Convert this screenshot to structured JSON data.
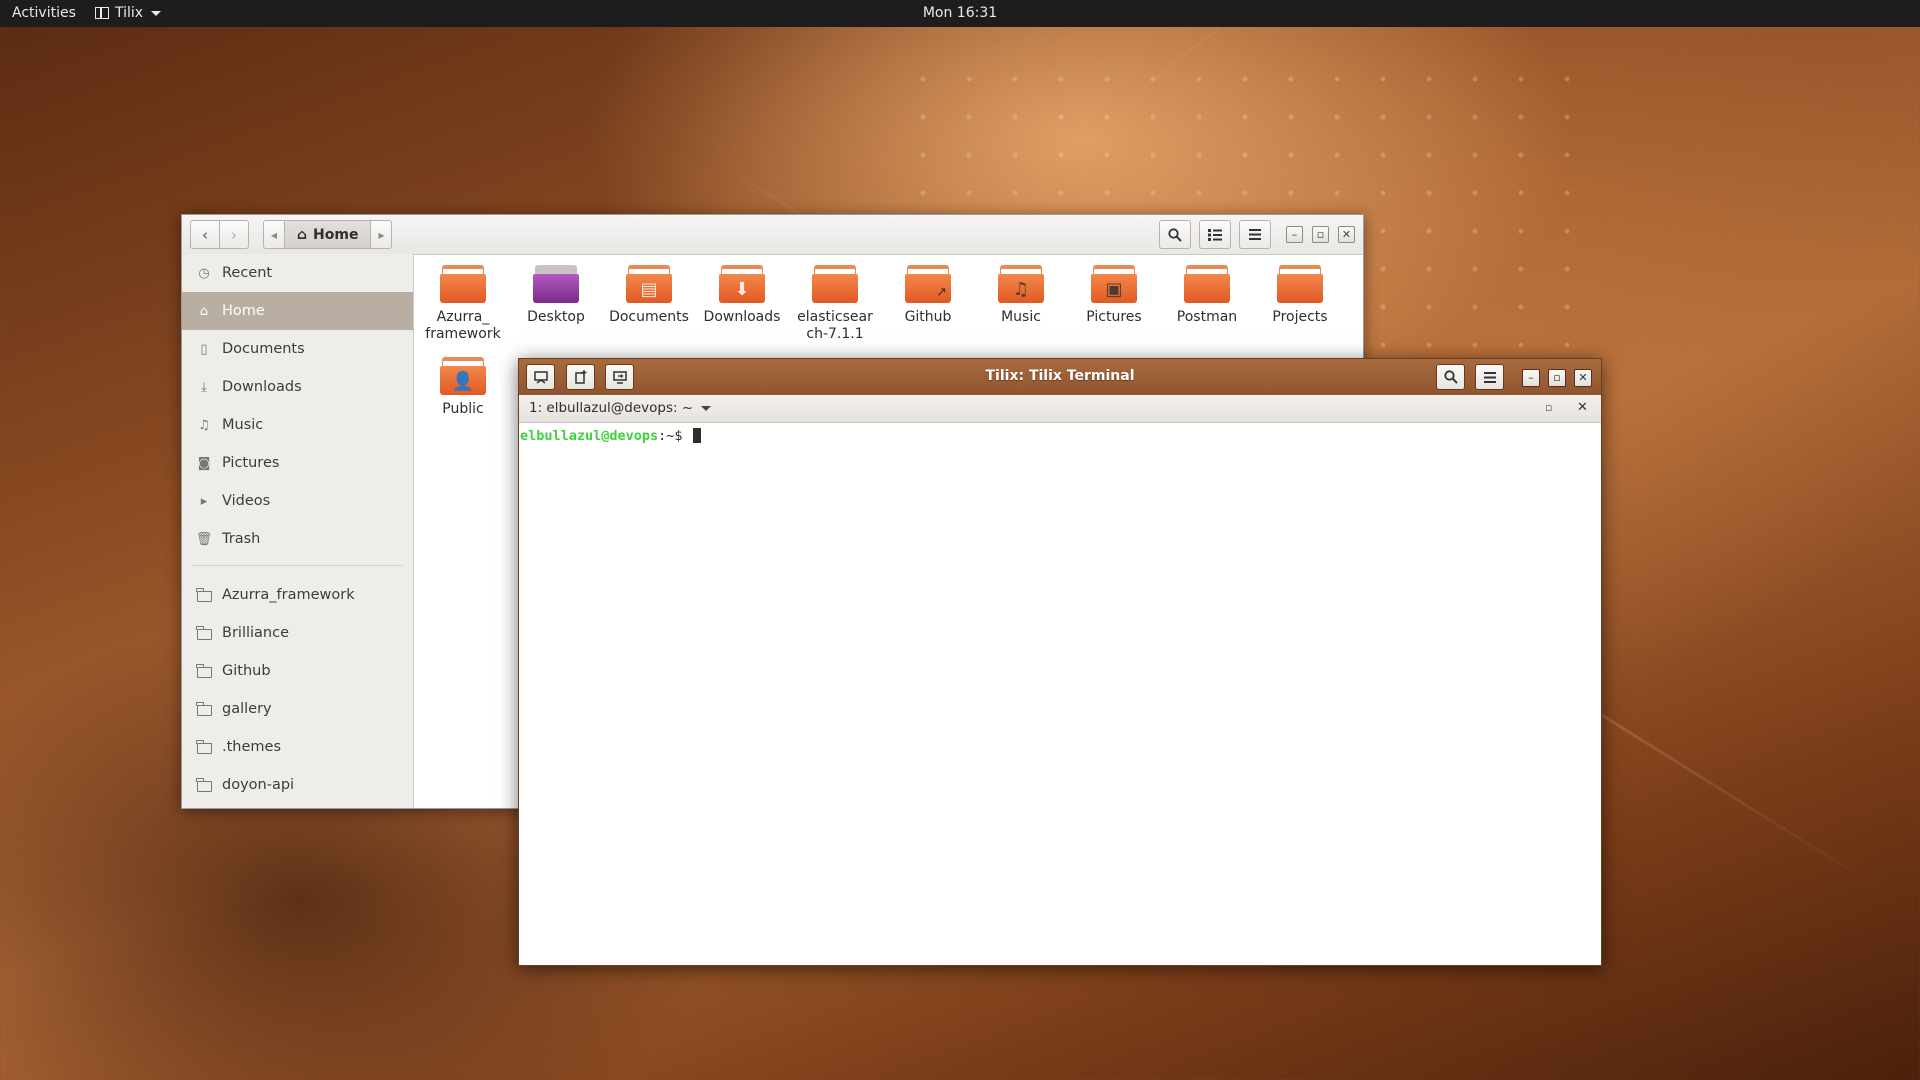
{
  "topbar": {
    "activities": "Activities",
    "app_name": "Tilix",
    "clock": "Mon 16:31"
  },
  "files": {
    "path": {
      "current": "Home"
    },
    "sidebar": {
      "places": [
        {
          "label": "Recent",
          "icon": "clock-icon"
        },
        {
          "label": "Home",
          "icon": "home-icon",
          "selected": true
        },
        {
          "label": "Documents",
          "icon": "document-icon"
        },
        {
          "label": "Downloads",
          "icon": "download-icon"
        },
        {
          "label": "Music",
          "icon": "music-icon"
        },
        {
          "label": "Pictures",
          "icon": "camera-icon"
        },
        {
          "label": "Videos",
          "icon": "video-icon"
        },
        {
          "label": "Trash",
          "icon": "trash-icon"
        }
      ],
      "bookmarks": [
        {
          "label": "Azurra_framework"
        },
        {
          "label": "Brilliance"
        },
        {
          "label": "Github"
        },
        {
          "label": "gallery"
        },
        {
          "label": ".themes"
        },
        {
          "label": "doyon-api"
        }
      ]
    },
    "items": [
      {
        "label": "Azurra_\nframework",
        "icon": "folder-icon"
      },
      {
        "label": "Desktop",
        "icon": "desktop-folder-icon"
      },
      {
        "label": "Documents",
        "icon": "documents-folder-icon"
      },
      {
        "label": "Downloads",
        "icon": "downloads-folder-icon"
      },
      {
        "label": "elasticsear\nch-7.1.1",
        "icon": "folder-icon"
      },
      {
        "label": "Github",
        "icon": "link-folder-icon"
      },
      {
        "label": "Music",
        "icon": "music-folder-icon"
      },
      {
        "label": "Pictures",
        "icon": "pictures-folder-icon"
      },
      {
        "label": "Postman",
        "icon": "folder-icon"
      },
      {
        "label": "Projects",
        "icon": "folder-icon"
      },
      {
        "label": "Public",
        "icon": "public-folder-icon"
      }
    ]
  },
  "tilix": {
    "title": "Tilix: Tilix Terminal",
    "session_label": "1: elbullazul@devops: ~",
    "prompt_user": "elbullazul@devops",
    "prompt_path": ":~$ "
  },
  "colors": {
    "accent": "#e05a24",
    "titlebar": "#9a5e35",
    "prompt_green": "#3fd23f",
    "sidebar_selected": "#b8aea2"
  }
}
